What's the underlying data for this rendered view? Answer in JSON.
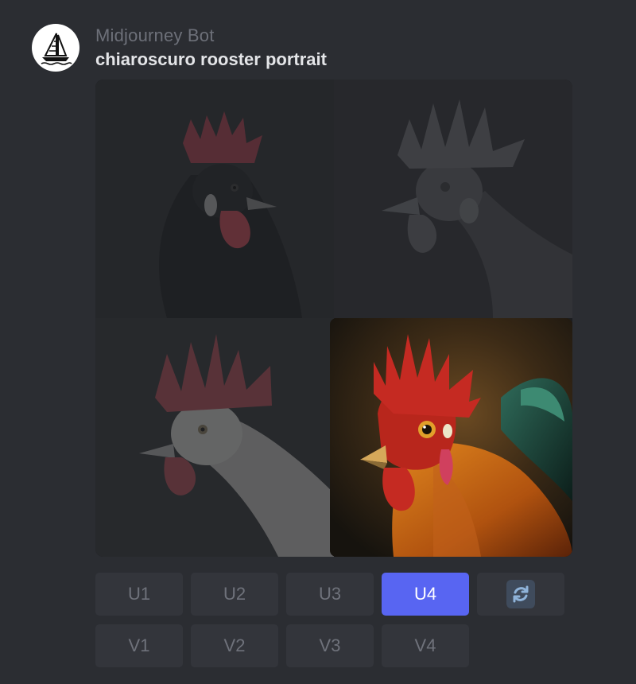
{
  "message": {
    "author": "Midjourney Bot",
    "prompt": "chiaroscuro rooster portrait"
  },
  "images": [
    {
      "name": "rooster-image-1",
      "selected": false
    },
    {
      "name": "rooster-image-2",
      "selected": false
    },
    {
      "name": "rooster-image-3",
      "selected": false
    },
    {
      "name": "rooster-image-4",
      "selected": true
    }
  ],
  "buttons": {
    "upscale": [
      "U1",
      "U2",
      "U3",
      "U4"
    ],
    "variation": [
      "V1",
      "V2",
      "V3",
      "V4"
    ],
    "active": "U4",
    "reroll_icon": "reroll-icon"
  },
  "colors": {
    "background": "#2b2d32",
    "button": "#33353b",
    "button_active": "#5865f2",
    "text_muted": "#6f727b"
  }
}
